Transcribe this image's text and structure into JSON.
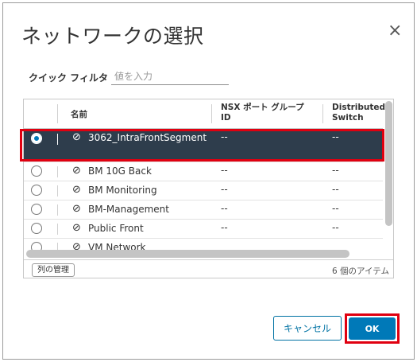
{
  "dialog": {
    "title": "ネットワークの選択",
    "close_icon": "×"
  },
  "filter": {
    "label": "クイック フィルタ",
    "placeholder": "値を入力",
    "value": ""
  },
  "grid": {
    "columns": [
      {
        "label": "名前"
      },
      {
        "label": "NSX ポート グループ ID"
      },
      {
        "label": "Distributed Switch"
      }
    ],
    "rows": [
      {
        "name": "3062_IntraFrontSegment",
        "nsx": "--",
        "dsw": "--",
        "selected": true
      },
      {
        "name": "BM 10G Back",
        "nsx": "--",
        "dsw": "--",
        "selected": false
      },
      {
        "name": "BM Monitoring",
        "nsx": "--",
        "dsw": "--",
        "selected": false
      },
      {
        "name": "BM-Management",
        "nsx": "--",
        "dsw": "--",
        "selected": false
      },
      {
        "name": "Public Front",
        "nsx": "--",
        "dsw": "--",
        "selected": false
      },
      {
        "name": "VM Network",
        "nsx": "",
        "dsw": "",
        "selected": false
      }
    ],
    "manage_columns_label": "列の管理",
    "item_count": "6 個のアイテム"
  },
  "buttons": {
    "cancel": "キャンセル",
    "ok": "OK"
  },
  "icons": {
    "close": "close-icon",
    "network": "network-icon"
  },
  "colors": {
    "accent": "#0079b8",
    "selected_row_bg": "#2e3d4c",
    "highlight_red": "#e00010"
  }
}
